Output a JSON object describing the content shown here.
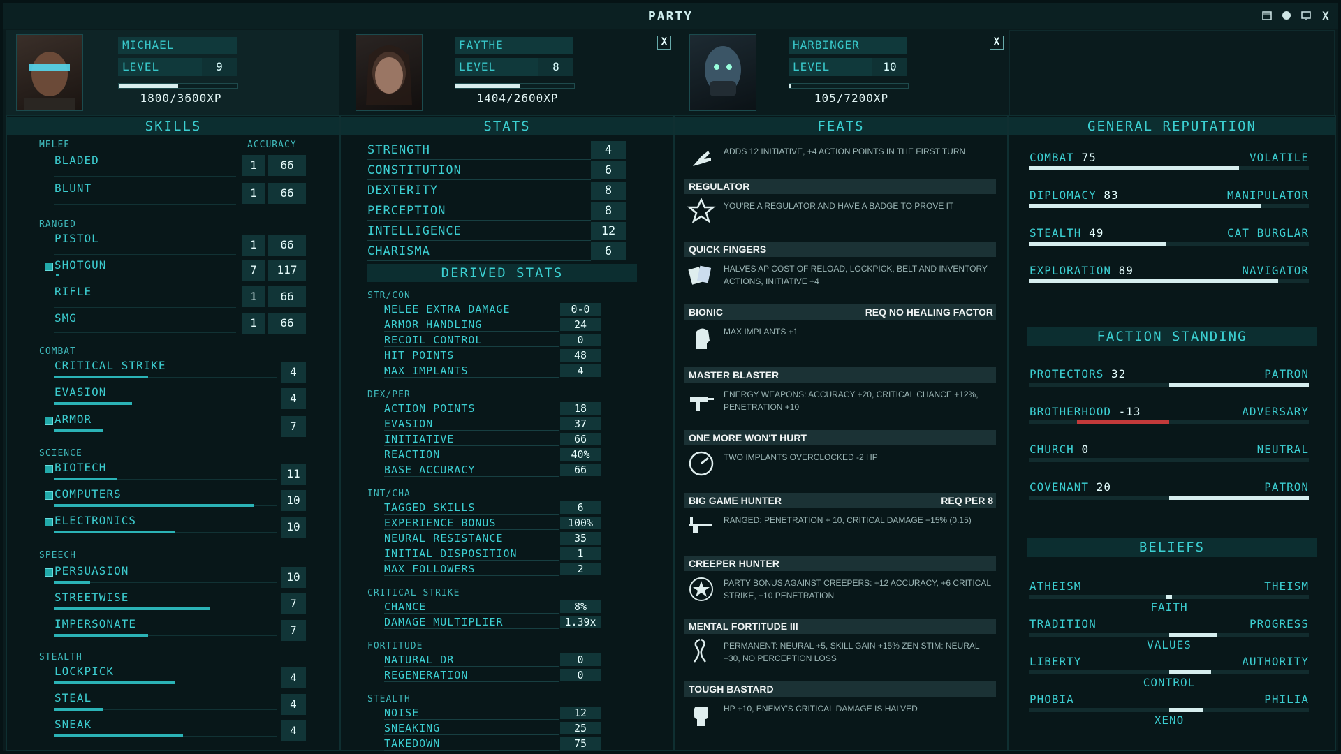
{
  "title": "PARTY",
  "window_buttons": [
    "calendar-icon",
    "brain-icon",
    "monitor-icon",
    "close-icon"
  ],
  "close_label": "X",
  "party": [
    {
      "name": "MICHAEL",
      "level_label": "LEVEL",
      "level": "9",
      "xp": "1800/3600XP",
      "xp_fraction": 0.5
    },
    {
      "name": "FAYTHE",
      "level_label": "LEVEL",
      "level": "8",
      "xp": "1404/2600XP",
      "xp_fraction": 0.54
    },
    {
      "name": "HARBINGER",
      "level_label": "LEVEL",
      "level": "10",
      "xp": "105/7200XP",
      "xp_fraction": 0.015
    }
  ],
  "skills": {
    "header": "SKILLS",
    "accuracy_label": "ACCURACY",
    "melee": {
      "label": "MELEE",
      "items": [
        {
          "name": "BLADED",
          "a": "1",
          "b": "66"
        },
        {
          "name": "BLUNT",
          "a": "1",
          "b": "66"
        }
      ]
    },
    "ranged": {
      "label": "RANGED",
      "items": [
        {
          "name": "PISTOL",
          "a": "1",
          "b": "66"
        },
        {
          "name": "SHOTGUN",
          "a": "7",
          "b": "117"
        },
        {
          "name": "RIFLE",
          "a": "1",
          "b": "66"
        },
        {
          "name": "SMG",
          "a": "1",
          "b": "66"
        }
      ]
    },
    "combat": {
      "label": "COMBAT",
      "items": [
        {
          "name": "CRITICAL STRIKE",
          "v": "4",
          "fill": 0.42
        },
        {
          "name": "EVASION",
          "v": "4",
          "fill": 0.35
        },
        {
          "name": "ARMOR",
          "v": "7",
          "fill": 0.22
        }
      ]
    },
    "science": {
      "label": "SCIENCE",
      "items": [
        {
          "name": "BIOTECH",
          "v": "11",
          "fill": 0.28
        },
        {
          "name": "COMPUTERS",
          "v": "10",
          "fill": 0.9
        },
        {
          "name": "ELECTRONICS",
          "v": "10",
          "fill": 0.54
        }
      ]
    },
    "speech": {
      "label": "SPEECH",
      "items": [
        {
          "name": "PERSUASION",
          "v": "10",
          "fill": 0.16
        },
        {
          "name": "STREETWISE",
          "v": "7",
          "fill": 0.7
        },
        {
          "name": "IMPERSONATE",
          "v": "7",
          "fill": 0.42
        }
      ]
    },
    "stealth": {
      "label": "STEALTH",
      "items": [
        {
          "name": "LOCKPICK",
          "v": "4",
          "fill": 0.54
        },
        {
          "name": "STEAL",
          "v": "4",
          "fill": 0.22
        },
        {
          "name": "SNEAK",
          "v": "4",
          "fill": 0.58
        }
      ]
    }
  },
  "stats": {
    "header": "STATS",
    "primary": [
      {
        "name": "STRENGTH",
        "v": "4"
      },
      {
        "name": "CONSTITUTION",
        "v": "6"
      },
      {
        "name": "DEXTERITY",
        "v": "8"
      },
      {
        "name": "PERCEPTION",
        "v": "8"
      },
      {
        "name": "INTELLIGENCE",
        "v": "12"
      },
      {
        "name": "CHARISMA",
        "v": "6"
      }
    ],
    "derived_header": "DERIVED STATS",
    "groups": [
      {
        "label": "STR/CON",
        "rows": [
          {
            "n": "MELEE EXTRA DAMAGE",
            "v": "0-0"
          },
          {
            "n": "ARMOR HANDLING",
            "v": "24"
          },
          {
            "n": "RECOIL CONTROL",
            "v": "0"
          },
          {
            "n": "HIT POINTS",
            "v": "48"
          },
          {
            "n": "MAX IMPLANTS",
            "v": "4"
          }
        ]
      },
      {
        "label": "DEX/PER",
        "rows": [
          {
            "n": "ACTION POINTS",
            "v": "18"
          },
          {
            "n": "EVASION",
            "v": "37"
          },
          {
            "n": "INITIATIVE",
            "v": "66"
          },
          {
            "n": "REACTION",
            "v": "40%"
          },
          {
            "n": "BASE ACCURACY",
            "v": "66"
          }
        ]
      },
      {
        "label": "INT/CHA",
        "rows": [
          {
            "n": "TAGGED SKILLS",
            "v": "6"
          },
          {
            "n": "EXPERIENCE BONUS",
            "v": "100%"
          },
          {
            "n": "NEURAL RESISTANCE",
            "v": "35"
          },
          {
            "n": "INITIAL DISPOSITION",
            "v": "1"
          },
          {
            "n": "MAX FOLLOWERS",
            "v": "2"
          }
        ]
      },
      {
        "label": "CRITICAL STRIKE",
        "rows": [
          {
            "n": "CHANCE",
            "v": "8%"
          },
          {
            "n": "DAMAGE MULTIPLIER",
            "v": "1.39x"
          }
        ]
      },
      {
        "label": "FORTITUDE",
        "rows": [
          {
            "n": "NATURAL DR",
            "v": "0"
          },
          {
            "n": "REGENERATION",
            "v": "0"
          }
        ]
      },
      {
        "label": "STEALTH",
        "rows": [
          {
            "n": "NOISE",
            "v": "12"
          },
          {
            "n": "SNEAKING",
            "v": "25"
          },
          {
            "n": "TAKEDOWN",
            "v": "75"
          }
        ]
      }
    ]
  },
  "feats": {
    "header": "FEATS",
    "items": [
      {
        "title": "",
        "req": "",
        "desc": "ADDS 12 INITIATIVE, +4 ACTION POINTS IN THE FIRST TURN",
        "icon": "hand-icon"
      },
      {
        "title": "REGULATOR",
        "req": "",
        "desc": "YOU'RE A REGULATOR AND HAVE A BADGE TO PROVE IT",
        "icon": "badge-icon"
      },
      {
        "title": "QUICK FINGERS",
        "req": "",
        "desc": "HALVES AP COST OF RELOAD, LOCKPICK, BELT AND INVENTORY ACTIONS, INITIATIVE +4",
        "icon": "cards-icon"
      },
      {
        "title": "BIONIC",
        "req": "REQ NO HEALING FACTOR",
        "desc": "MAX IMPLANTS +1",
        "icon": "cyborg-head-icon"
      },
      {
        "title": "MASTER BLASTER",
        "req": "",
        "desc": "ENERGY WEAPONS: ACCURACY +20, CRITICAL CHANCE +12%, PENETRATION +10",
        "icon": "blaster-icon"
      },
      {
        "title": "ONE MORE WON'T HURT",
        "req": "",
        "desc": "TWO IMPLANTS OVERCLOCKED -2 HP",
        "icon": "gauge-icon"
      },
      {
        "title": "BIG GAME HUNTER",
        "req": "REQ PER 8",
        "desc": "RANGED: PENETRATION + 10, CRITICAL DAMAGE +15% (0.15)",
        "icon": "rifle-icon"
      },
      {
        "title": "CREEPER HUNTER",
        "req": "",
        "desc": "PARTY BONUS AGAINST CREEPERS: +12 ACCURACY, +6 CRITICAL STRIKE, +10 PENETRATION",
        "icon": "crosshair-star-icon"
      },
      {
        "title": "MENTAL FORTITUDE III",
        "req": "",
        "desc": "PERMANENT: NEURAL +5, SKILL GAIN +15% ZEN STIM: NEURAL +30, NO PERCEPTION LOSS",
        "icon": "dna-icon"
      },
      {
        "title": "TOUGH BASTARD",
        "req": "",
        "desc": "HP +10, ENEMY'S CRITICAL DAMAGE IS HALVED",
        "icon": "fist-icon"
      }
    ]
  },
  "reputation": {
    "header": "GENERAL REPUTATION",
    "items": [
      {
        "name": "COMBAT",
        "v": "75",
        "right": "VOLATILE",
        "fill": 0.75
      },
      {
        "name": "DIPLOMACY",
        "v": "83",
        "right": "MANIPULATOR",
        "fill": 0.83
      },
      {
        "name": "STEALTH",
        "v": "49",
        "right": "CAT BURGLAR",
        "fill": 0.49
      },
      {
        "name": "EXPLORATION",
        "v": "89",
        "right": "NAVIGATOR",
        "fill": 0.89
      }
    ]
  },
  "factions": {
    "header": "FACTION STANDING",
    "items": [
      {
        "name": "PROTECTORS",
        "v": "32",
        "right": "PATRON",
        "from": 0.5,
        "to": 1.0,
        "color": "#d6eeee"
      },
      {
        "name": "BROTHERHOOD",
        "v": "-13",
        "right": "ADVERSARY",
        "from": 0.17,
        "to": 0.5,
        "color": "#c23a3a"
      },
      {
        "name": "CHURCH",
        "v": "0",
        "right": "NEUTRAL",
        "from": 0.5,
        "to": 0.5,
        "color": "#d6eeee"
      },
      {
        "name": "COVENANT",
        "v": "20",
        "right": "PATRON",
        "from": 0.5,
        "to": 1.0,
        "color": "#d6eeee"
      }
    ]
  },
  "beliefs": {
    "header": "BELIEFS",
    "items": [
      {
        "left": "ATHEISM",
        "right": "THEISM",
        "center": "FAITH",
        "from": 0.49,
        "to": 0.51
      },
      {
        "left": "TRADITION",
        "right": "PROGRESS",
        "center": "VALUES",
        "from": 0.5,
        "to": 0.67
      },
      {
        "left": "LIBERTY",
        "right": "AUTHORITY",
        "center": "CONTROL",
        "from": 0.5,
        "to": 0.65
      },
      {
        "left": "PHOBIA",
        "right": "PHILIA",
        "center": "XENO",
        "from": 0.5,
        "to": 0.62
      }
    ]
  }
}
